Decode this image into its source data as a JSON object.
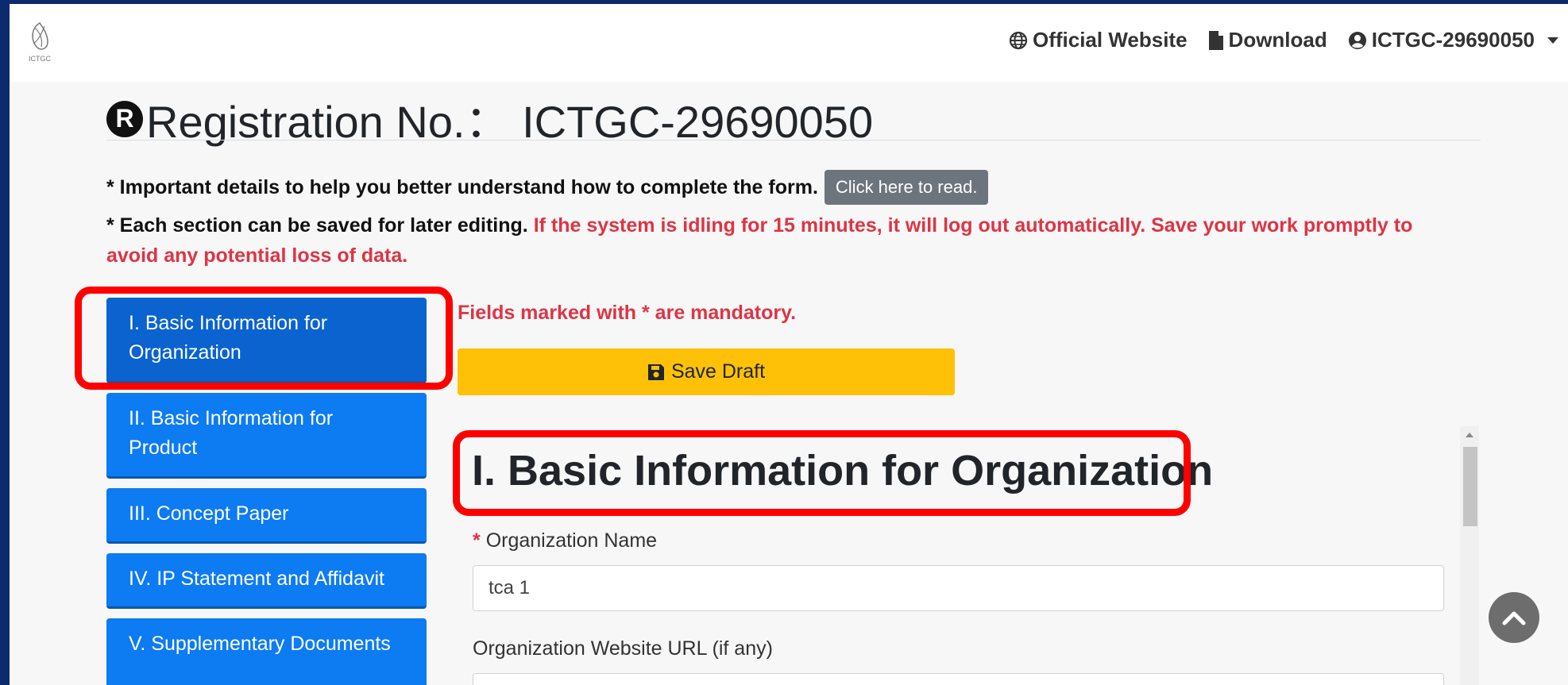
{
  "nav": {
    "official_website": "Official Website",
    "download": "Download",
    "user": "ICTGC-29690050"
  },
  "logo_text": "ICTGC",
  "title": {
    "badge": "R",
    "text": "Registration No.： ICTGC-29690050"
  },
  "notes": {
    "note1": "* Important details to help you better understand how to complete the form.",
    "read_button": "Click here to read.",
    "note2_black": "* Each section can be saved for later editing.",
    "note2_red": "If the system is idling for 15 minutes, it will log out automatically. Save your work promptly to avoid any potential loss of data."
  },
  "sidebar": {
    "items": [
      {
        "label": "I. Basic Information for Organization"
      },
      {
        "label": "II. Basic Information for Product"
      },
      {
        "label": "III. Concept Paper"
      },
      {
        "label": "IV. IP Statement and Affidavit"
      },
      {
        "label": "V. Supplementary Documents"
      }
    ]
  },
  "form": {
    "mandatory_note": "Fields marked with * are mandatory.",
    "save_draft": "Save Draft",
    "section_title": "I. Basic Information for Organization",
    "org_name_label": "Organization Name",
    "org_name_value": "tca 1",
    "website_label": "Organization Website URL (if any)",
    "website_value": ""
  },
  "colors": {
    "sidebar_blue": "#0d7bf2",
    "save_yellow": "#ffc107",
    "alert_red": "#dc3545",
    "highlight_red": "#ff0000"
  }
}
